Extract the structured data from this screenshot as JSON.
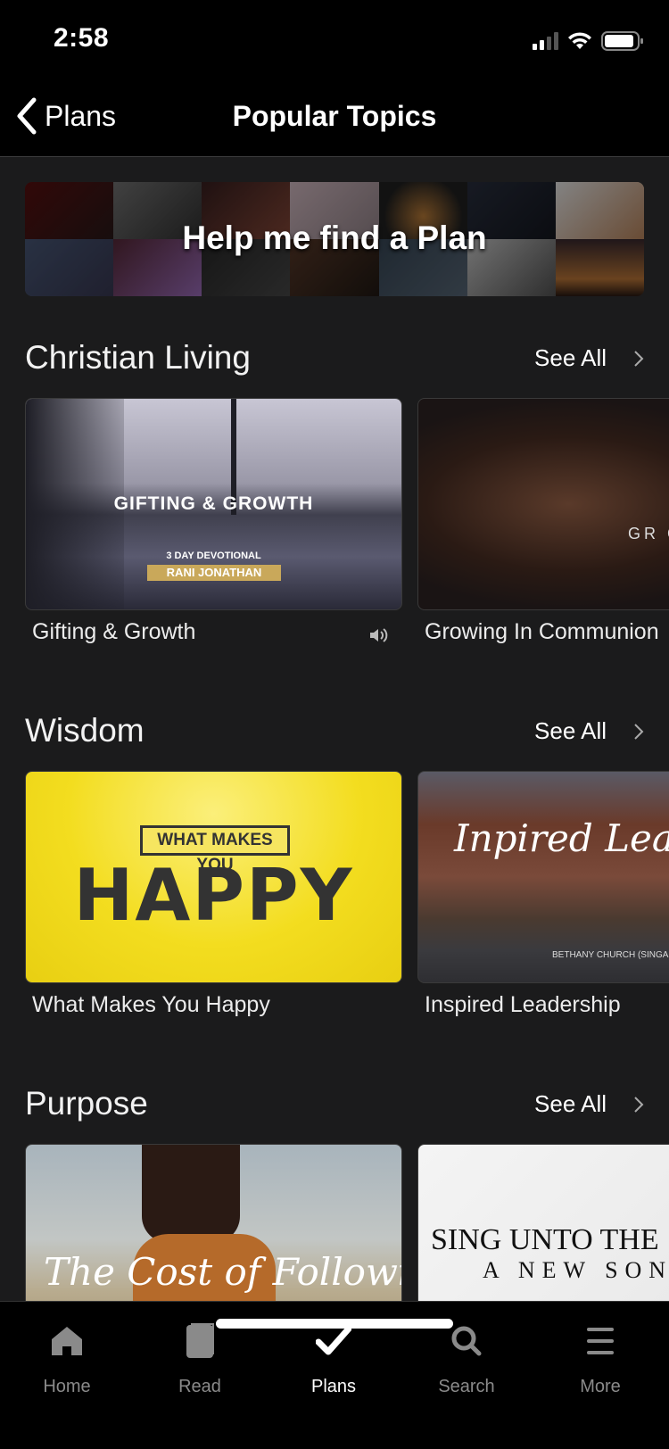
{
  "status_bar": {
    "time": "2:58",
    "signal_bars": 2,
    "battery_percent": 85
  },
  "nav": {
    "back_label": "Plans",
    "title": "Popular Topics"
  },
  "banner": {
    "label": "Help me find a Plan"
  },
  "sections": [
    {
      "title": "Christian Living",
      "see_all": "See All",
      "cards": [
        {
          "title": "Gifting & Growth",
          "image_text": "GIFTING & GROWTH",
          "image_subtext": "3 DAY DEVOTIONAL",
          "image_author": "RANI JONATHAN",
          "has_audio": true
        },
        {
          "title": "Growing In Communion",
          "image_text": "GR COM WI"
        }
      ]
    },
    {
      "title": "Wisdom",
      "see_all": "See All",
      "cards": [
        {
          "title": "What Makes You Happy",
          "image_banner": "WHAT MAKES YOU",
          "image_text": "HAPPY"
        },
        {
          "title": "Inspired Leadership",
          "image_text": "Inpired Leade",
          "image_subtext": "BETHANY CHURCH (SINGAPORE)"
        }
      ]
    },
    {
      "title": "Purpose",
      "see_all": "See All",
      "cards": [
        {
          "image_text": "The Cost of Following"
        },
        {
          "image_text": "SING UNTO THE",
          "image_subtext": "A NEW SON"
        }
      ]
    }
  ],
  "tabs": [
    {
      "label": "Home",
      "icon": "home-icon",
      "active": false
    },
    {
      "label": "Read",
      "icon": "book-icon",
      "active": false
    },
    {
      "label": "Plans",
      "icon": "checkmark-icon",
      "active": true
    },
    {
      "label": "Search",
      "icon": "search-icon",
      "active": false
    },
    {
      "label": "More",
      "icon": "menu-icon",
      "active": false
    }
  ],
  "colors": {
    "background": "#1b1b1c",
    "bar_background": "#000000",
    "active_tab": "#ffffff",
    "inactive_tab": "#8a8a8a",
    "gold_accent": "#c9a85a",
    "happy_yellow": "#f3dd1f"
  }
}
